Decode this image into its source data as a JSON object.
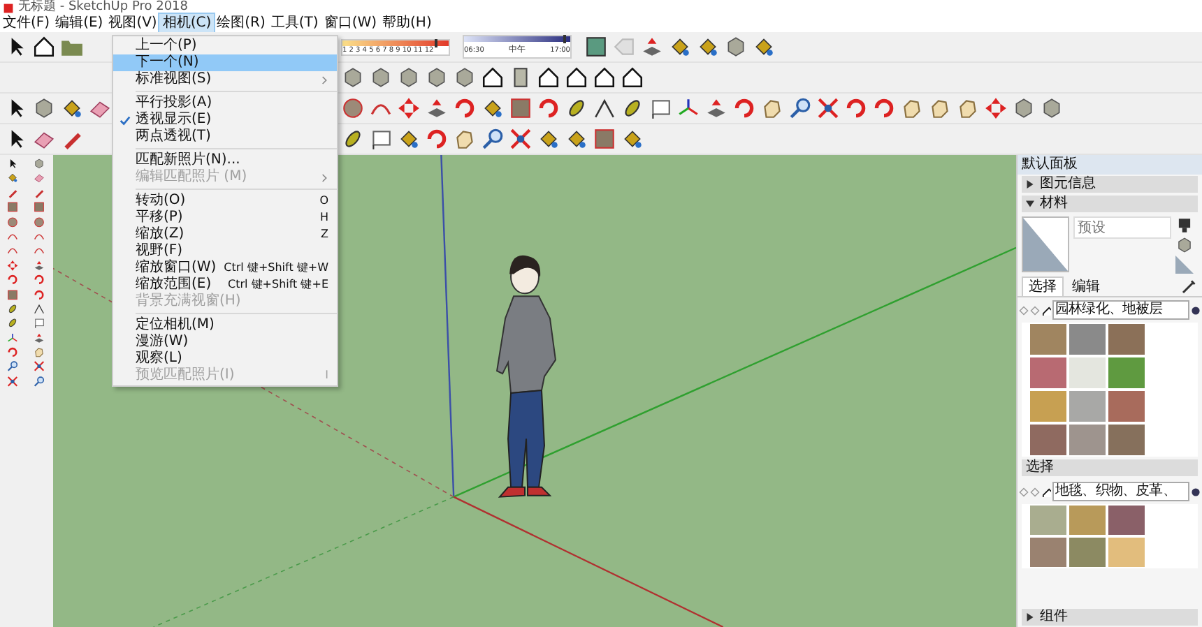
{
  "window": {
    "title": "无标题 - SketchUp Pro 2018"
  },
  "menu_bar": [
    {
      "label": "文件(F)",
      "selected": false
    },
    {
      "label": "编辑(E)",
      "selected": false
    },
    {
      "label": "视图(V)",
      "selected": false
    },
    {
      "label": "相机(C)",
      "selected": true
    },
    {
      "label": "绘图(R)",
      "selected": false
    },
    {
      "label": "工具(T)",
      "selected": false
    },
    {
      "label": "窗口(W)",
      "selected": false
    },
    {
      "label": "帮助(H)",
      "selected": false
    }
  ],
  "shadow_settings": {
    "month_slider": {
      "level": 0.88,
      "scale": "1 2 3 4 5 6 7 8 9 10 11 12"
    },
    "time_slider": {
      "level": 0.95,
      "start": "06:30",
      "mid": "中午",
      "end": "17:00"
    }
  },
  "camera_menu": [
    {
      "kind": "item",
      "label": "上一个(P)",
      "selected": false,
      "checked": false,
      "disabled": false
    },
    {
      "kind": "item",
      "label": "下一个(N)",
      "selected": true,
      "checked": false,
      "disabled": false
    },
    {
      "kind": "item",
      "label": "标准视图(S)",
      "selected": false,
      "checked": false,
      "disabled": false,
      "submenu": true
    },
    {
      "kind": "separator"
    },
    {
      "kind": "item",
      "label": "平行投影(A)",
      "selected": false,
      "checked": false,
      "disabled": false
    },
    {
      "kind": "item",
      "label": "透视显示(E)",
      "selected": false,
      "checked": true,
      "disabled": false
    },
    {
      "kind": "item",
      "label": "两点透视(T)",
      "selected": false,
      "checked": false,
      "disabled": false
    },
    {
      "kind": "separator"
    },
    {
      "kind": "item",
      "label": "匹配新照片(N)...",
      "selected": false,
      "checked": false,
      "disabled": false
    },
    {
      "kind": "item",
      "label": "编辑匹配照片 (M)",
      "selected": false,
      "checked": false,
      "disabled": true,
      "submenu": true
    },
    {
      "kind": "separator"
    },
    {
      "kind": "item",
      "label": "转动(O)",
      "shortcut": "O",
      "selected": false,
      "checked": false,
      "disabled": false
    },
    {
      "kind": "item",
      "label": "平移(P)",
      "shortcut": "H",
      "selected": false,
      "checked": false,
      "disabled": false
    },
    {
      "kind": "item",
      "label": "缩放(Z)",
      "shortcut": "Z",
      "selected": false,
      "checked": false,
      "disabled": false
    },
    {
      "kind": "item",
      "label": "视野(F)",
      "selected": false,
      "checked": false,
      "disabled": false
    },
    {
      "kind": "item",
      "label": "缩放窗口(W)",
      "shortcut": "Ctrl 键+Shift 键+W",
      "selected": false,
      "checked": false,
      "disabled": false
    },
    {
      "kind": "item",
      "label": "缩放范围(E)",
      "shortcut": "Ctrl 键+Shift 键+E",
      "selected": false,
      "checked": false,
      "disabled": false
    },
    {
      "kind": "item",
      "label": "背景充满视窗(H)",
      "selected": false,
      "checked": false,
      "disabled": true
    },
    {
      "kind": "separator"
    },
    {
      "kind": "item",
      "label": "定位相机(M)",
      "selected": false,
      "checked": false,
      "disabled": false
    },
    {
      "kind": "item",
      "label": "漫游(W)",
      "selected": false,
      "checked": false,
      "disabled": false
    },
    {
      "kind": "item",
      "label": "观察(L)",
      "selected": false,
      "checked": false,
      "disabled": false
    },
    {
      "kind": "item",
      "label": "预览匹配照片(I)",
      "shortcut": "I",
      "selected": false,
      "checked": false,
      "disabled": true
    }
  ],
  "tray": {
    "title": "默认面板",
    "sections": [
      {
        "title": "图元信息",
        "expanded": false
      },
      {
        "title": "材料",
        "expanded": true
      }
    ],
    "material_name": {
      "placeholder": "预设"
    },
    "tabs": [
      {
        "label": "选择",
        "selected": true
      },
      {
        "label": "编辑",
        "selected": false
      }
    ],
    "library": "园林绿化、地被层",
    "swatches": [
      {
        "color": "#a08560"
      },
      {
        "color": "#8a8a8a"
      },
      {
        "color": "#8b7058"
      },
      {
        "color": "#b86a72"
      },
      {
        "color": "#e4e6df"
      },
      {
        "color": "#5f9a40"
      },
      {
        "color": "#c7a052"
      },
      {
        "color": "#a8a8a6"
      },
      {
        "color": "#a86b5c"
      },
      {
        "color": "#8f6a60"
      },
      {
        "color": "#9e948e"
      },
      {
        "color": "#86705c"
      }
    ],
    "second_label": "选择",
    "second_library": "地毯、织物、皮革、",
    "second_swatches": [
      {
        "color": "#a9ad8f"
      },
      {
        "color": "#b89a5a"
      },
      {
        "color": "#8a6068"
      },
      {
        "color": "#9a8270"
      },
      {
        "color": "#8c8a62"
      },
      {
        "color": "#e2bd7d"
      }
    ],
    "components": {
      "title": "组件",
      "expanded": false
    }
  }
}
